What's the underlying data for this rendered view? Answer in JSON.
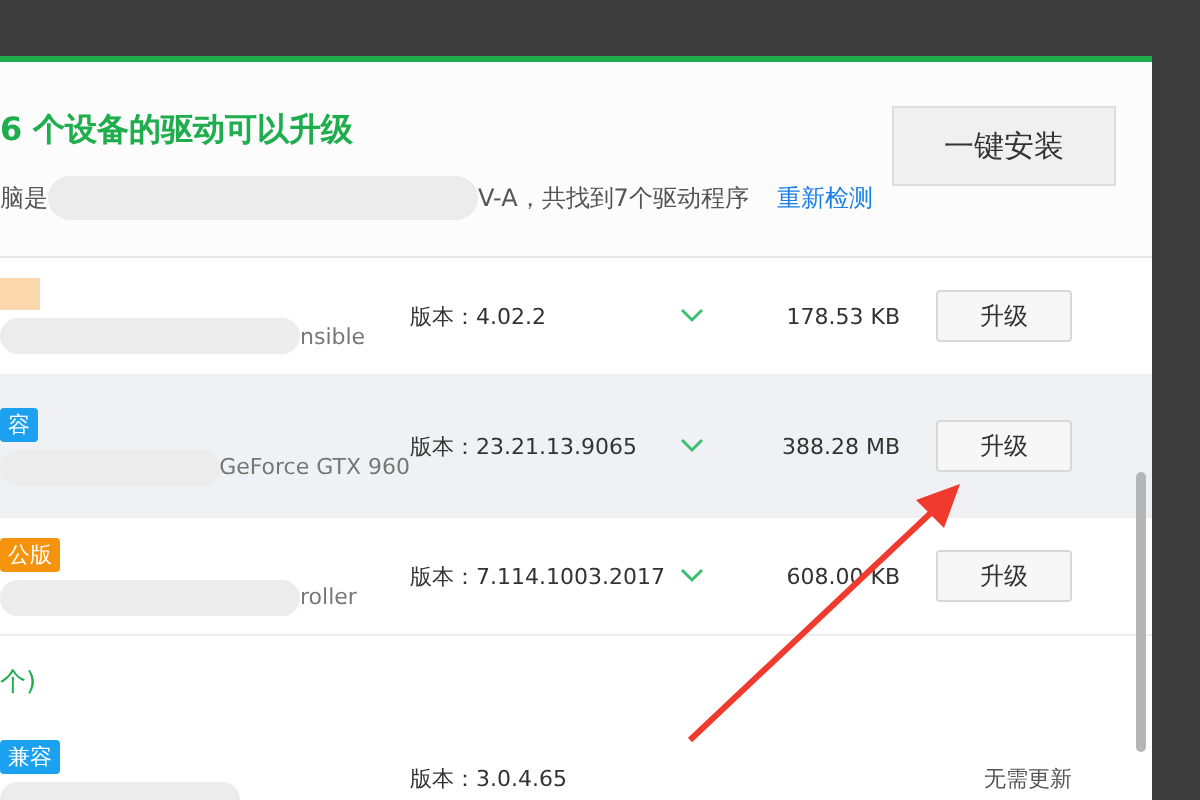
{
  "header": {
    "title": "6 个设备的驱动可以升级",
    "info_prefix": "脑是",
    "info_suffix": "V-A，共找到7个驱动程序",
    "rescan_link": "重新检测",
    "install_all_button": "一键安装"
  },
  "drivers": [
    {
      "kind": "upgradable",
      "name": "nsible",
      "version": "版本：4.02.2",
      "size": "178.53 KB",
      "action": "升级",
      "highlighted": false,
      "expandable": true
    },
    {
      "kind": "upgradable",
      "tag": {
        "kind": "compatible",
        "text": "容"
      },
      "name": "GeForce GTX 960",
      "version": "版本：23.21.13.9065",
      "size": "388.28 MB",
      "action": "升级",
      "highlighted": true,
      "expandable": true
    },
    {
      "kind": "upgradable",
      "tag": {
        "kind": "official",
        "text": "公版"
      },
      "name": "roller",
      "version": "版本：7.114.1003.2017",
      "size": "608.00 KB",
      "action": "升级",
      "highlighted": false,
      "expandable": true
    }
  ],
  "section": {
    "title": "个)"
  },
  "ok_drivers": [
    {
      "kind": "current",
      "tag": {
        "kind": "compatible",
        "text": "兼容"
      },
      "version": "版本：3.0.4.65",
      "action": "无需更新",
      "highlighted": false,
      "expandable": false
    }
  ]
}
